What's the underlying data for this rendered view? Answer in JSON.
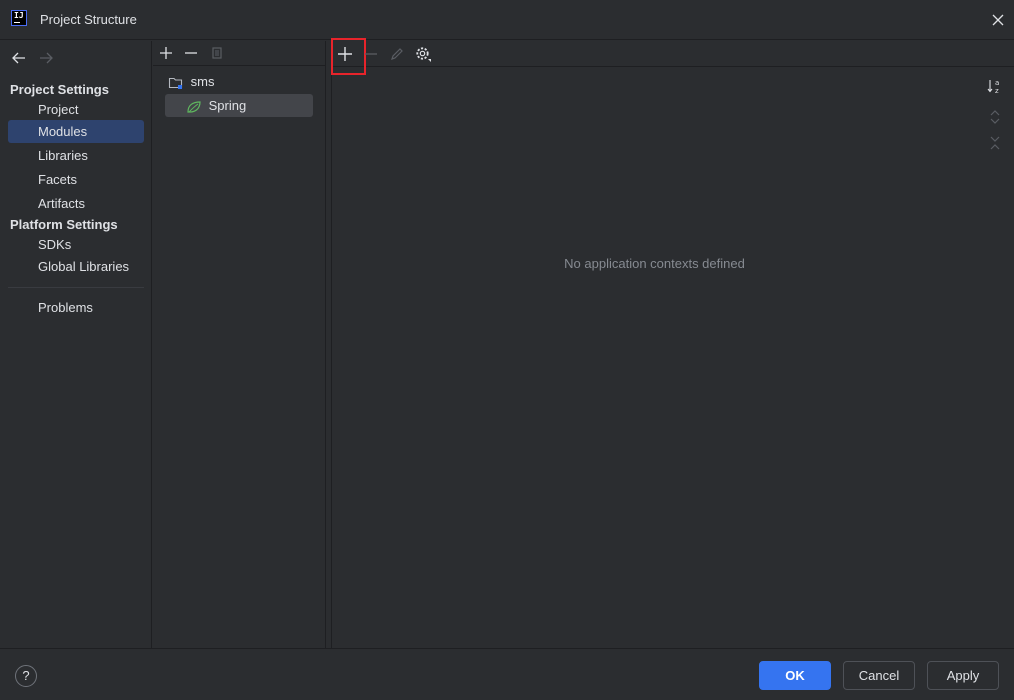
{
  "window": {
    "title": "Project Structure",
    "app_icon_text": "IJ"
  },
  "sidebar": {
    "project_settings_header": "Project Settings",
    "project_items": [
      {
        "label": "Project"
      },
      {
        "label": "Modules",
        "selected": true
      },
      {
        "label": "Libraries"
      },
      {
        "label": "Facets"
      },
      {
        "label": "Artifacts"
      }
    ],
    "platform_settings_header": "Platform Settings",
    "platform_items": [
      {
        "label": "SDKs"
      },
      {
        "label": "Global Libraries"
      }
    ],
    "problems_label": "Problems"
  },
  "modules_tree": {
    "root": "sms",
    "child": "Spring"
  },
  "main": {
    "empty_message": "No application contexts defined"
  },
  "footer": {
    "help_label": "?",
    "ok_label": "OK",
    "cancel_label": "Cancel",
    "apply_label": "Apply"
  },
  "colors": {
    "accent": "#3574f0",
    "selection": "#2e436e",
    "highlight_box": "#e8242b",
    "spring_green": "#5fb85f"
  }
}
